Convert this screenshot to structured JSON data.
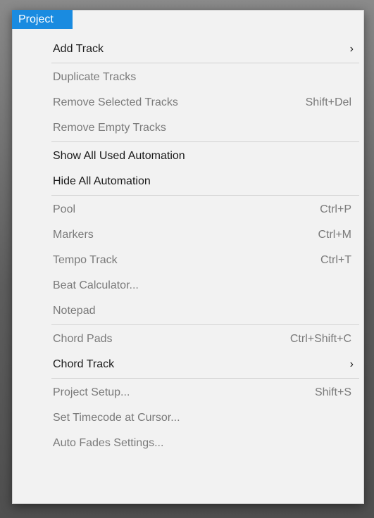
{
  "menu": {
    "title": "Project",
    "groups": [
      [
        {
          "label": "Add Track",
          "shortcut": "",
          "submenu": true,
          "enabled": true
        }
      ],
      [
        {
          "label": "Duplicate Tracks",
          "shortcut": "",
          "submenu": false,
          "enabled": false
        },
        {
          "label": "Remove Selected Tracks",
          "shortcut": "Shift+Del",
          "submenu": false,
          "enabled": false
        },
        {
          "label": "Remove Empty Tracks",
          "shortcut": "",
          "submenu": false,
          "enabled": false
        }
      ],
      [
        {
          "label": "Show All Used Automation",
          "shortcut": "",
          "submenu": false,
          "enabled": true
        },
        {
          "label": "Hide All Automation",
          "shortcut": "",
          "submenu": false,
          "enabled": true
        }
      ],
      [
        {
          "label": "Pool",
          "shortcut": "Ctrl+P",
          "submenu": false,
          "enabled": false
        },
        {
          "label": "Markers",
          "shortcut": "Ctrl+M",
          "submenu": false,
          "enabled": false
        },
        {
          "label": "Tempo Track",
          "shortcut": "Ctrl+T",
          "submenu": false,
          "enabled": false
        },
        {
          "label": "Beat Calculator...",
          "shortcut": "",
          "submenu": false,
          "enabled": false
        },
        {
          "label": "Notepad",
          "shortcut": "",
          "submenu": false,
          "enabled": false
        }
      ],
      [
        {
          "label": "Chord Pads",
          "shortcut": "Ctrl+Shift+C",
          "submenu": false,
          "enabled": false
        },
        {
          "label": "Chord Track",
          "shortcut": "",
          "submenu": true,
          "enabled": true
        }
      ],
      [
        {
          "label": "Project Setup...",
          "shortcut": "Shift+S",
          "submenu": false,
          "enabled": false
        },
        {
          "label": "Set Timecode at Cursor...",
          "shortcut": "",
          "submenu": false,
          "enabled": false
        },
        {
          "label": "Auto Fades Settings...",
          "shortcut": "",
          "submenu": false,
          "enabled": false
        }
      ]
    ],
    "submenu_glyph": "›"
  }
}
